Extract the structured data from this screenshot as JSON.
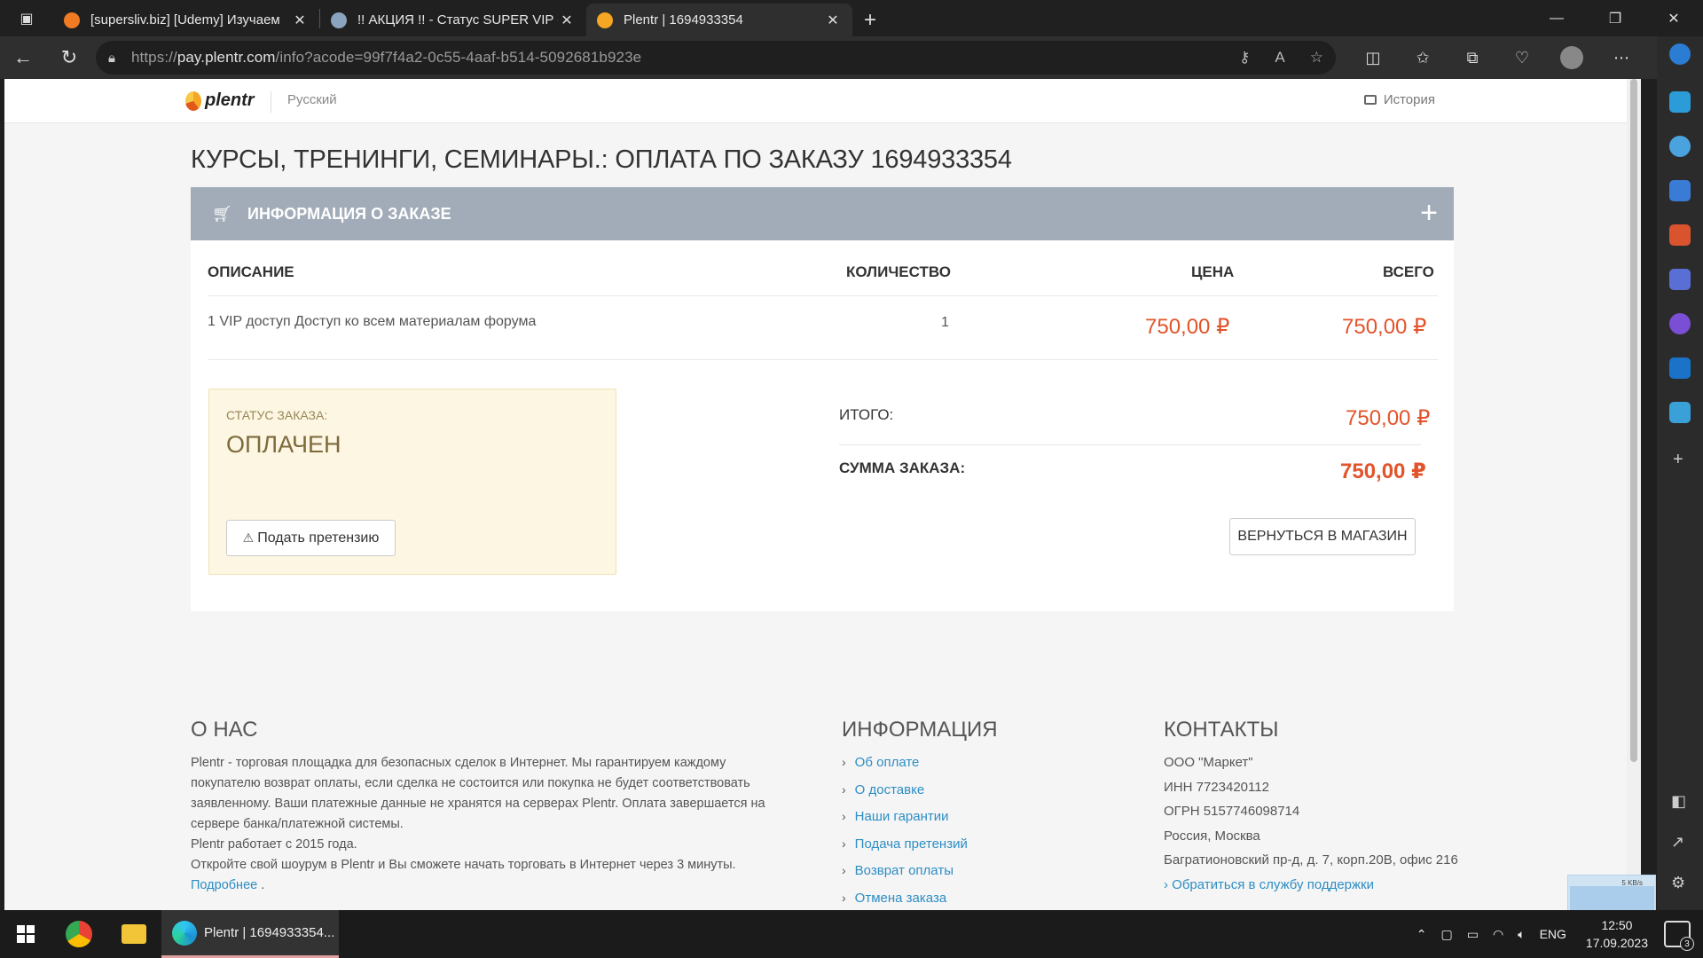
{
  "browser": {
    "tabs": [
      {
        "title": "[supersliv.biz] [Udemy] Изучаем",
        "favicon_color": "#f07b22"
      },
      {
        "title": "!! АКЦИЯ !! - Статус SUPER VIP с",
        "favicon_color": "#8aa4c0"
      },
      {
        "title": "Plentr | 1694933354",
        "favicon_color": "#f5a623"
      }
    ],
    "url_prefix": "https://",
    "url_host": "pay.plentr.com",
    "url_path": "/info?acode=99f7f4a2-0c55-4aaf-b514-5092681b923e"
  },
  "site": {
    "logo_text": "plentr",
    "language": "Русский",
    "history": "История"
  },
  "page_title": "КУРСЫ, ТРЕНИНГИ, СЕМИНАРЫ.: ОПЛАТА ПО ЗАКАЗУ 1694933354",
  "order": {
    "panel_title": "ИНФОРМАЦИЯ О ЗАКАЗЕ",
    "columns": {
      "description": "ОПИСАНИЕ",
      "quantity": "КОЛИЧЕСТВО",
      "price": "ЦЕНА",
      "total": "ВСЕГО"
    },
    "items": [
      {
        "description": "1 VIP доступ Доступ ко всем материалам форума",
        "quantity": "1",
        "price": "750,00 ₽",
        "total": "750,00 ₽"
      }
    ],
    "status_label": "СТАТУС ЗАКАЗА:",
    "status_value": "ОПЛАЧЕН",
    "claim_button": "Подать претензию",
    "subtotal_label": "ИТОГО:",
    "subtotal_value": "750,00 ₽",
    "sum_label": "СУММА ЗАКАЗА:",
    "sum_value": "750,00 ₽",
    "back_button": "ВЕРНУТЬСЯ В МАГАЗИН"
  },
  "footer": {
    "about_title": "О НАС",
    "about_lines": [
      "Plentr - торговая площадка для безопасных сделок в Интернет. Мы гарантируем каждому",
      "покупателю возврат оплаты, если сделка не состоится или покупка не будет соответствовать",
      "заявленному. Ваши платежные данные не хранятся на серверах Plentr. Оплата завершается на",
      "сервере банка/платежной системы.",
      "Plentr работает с 2015 года.",
      "Откройте свой шоурум в Plentr и Вы сможете начать торговать в Интернет через 3 минуты."
    ],
    "about_more": "Подробнее",
    "about_more_suffix": " .",
    "info_title": "ИНФОРМАЦИЯ",
    "info_links": [
      "Об оплате",
      "О доставке",
      "Наши гарантии",
      "Подача претензий",
      "Возврат оплаты",
      "Отмена заказа"
    ],
    "contacts_title": "КОНТАКТЫ",
    "contacts": [
      "ООО \"Маркет\"",
      "ИНН 7723420112",
      "ОГРН 5157746098714",
      "Россия, Москва",
      "Багратионовский пр-д, д. 7, корп.20В, офис 216"
    ],
    "support_link": "Обратиться в службу поддержки"
  },
  "net_widget": {
    "speed": "5 KB/s"
  },
  "taskbar": {
    "active_app": "Plentr | 1694933354...",
    "lang": "ENG",
    "time": "12:50",
    "date": "17.09.2023",
    "notifications": "3"
  }
}
